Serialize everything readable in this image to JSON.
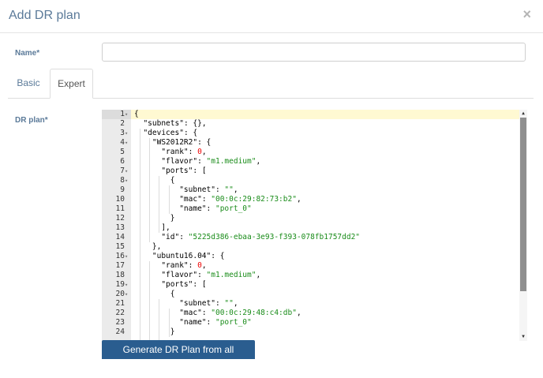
{
  "dialog": {
    "title": "Add DR plan",
    "close_icon": "×"
  },
  "form": {
    "name_label": "Name*",
    "name_value": "",
    "plan_label": "DR plan*"
  },
  "tabs": [
    {
      "label": "Basic",
      "active": false
    },
    {
      "label": "Expert",
      "active": true
    }
  ],
  "editor": {
    "lines": [
      {
        "n": "1",
        "fold": true,
        "active": true,
        "tokens": [
          [
            "pun",
            "{"
          ]
        ]
      },
      {
        "n": "2",
        "fold": false,
        "tokens": [
          [
            "pun",
            "  "
          ],
          [
            "key",
            "\"subnets\""
          ],
          [
            "pun",
            ": {},"
          ]
        ]
      },
      {
        "n": "3",
        "fold": true,
        "tokens": [
          [
            "pun",
            "  "
          ],
          [
            "key",
            "\"devices\""
          ],
          [
            "pun",
            ": {"
          ]
        ]
      },
      {
        "n": "4",
        "fold": true,
        "tokens": [
          [
            "pun",
            "    "
          ],
          [
            "key",
            "\"WS2012R2\""
          ],
          [
            "pun",
            ": {"
          ]
        ]
      },
      {
        "n": "5",
        "fold": false,
        "tokens": [
          [
            "pun",
            "      "
          ],
          [
            "key",
            "\"rank\""
          ],
          [
            "pun",
            ": "
          ],
          [
            "num",
            "0"
          ],
          [
            "pun",
            ","
          ]
        ]
      },
      {
        "n": "6",
        "fold": false,
        "tokens": [
          [
            "pun",
            "      "
          ],
          [
            "key",
            "\"flavor\""
          ],
          [
            "pun",
            ": "
          ],
          [
            "str",
            "\"m1.medium\""
          ],
          [
            "pun",
            ","
          ]
        ]
      },
      {
        "n": "7",
        "fold": true,
        "tokens": [
          [
            "pun",
            "      "
          ],
          [
            "key",
            "\"ports\""
          ],
          [
            "pun",
            ": ["
          ]
        ]
      },
      {
        "n": "8",
        "fold": true,
        "tokens": [
          [
            "pun",
            "        {"
          ]
        ]
      },
      {
        "n": "9",
        "fold": false,
        "tokens": [
          [
            "pun",
            "          "
          ],
          [
            "key",
            "\"subnet\""
          ],
          [
            "pun",
            ": "
          ],
          [
            "str",
            "\"\""
          ],
          [
            "pun",
            ","
          ]
        ]
      },
      {
        "n": "10",
        "fold": false,
        "tokens": [
          [
            "pun",
            "          "
          ],
          [
            "key",
            "\"mac\""
          ],
          [
            "pun",
            ": "
          ],
          [
            "str",
            "\"00:0c:29:82:73:b2\""
          ],
          [
            "pun",
            ","
          ]
        ]
      },
      {
        "n": "11",
        "fold": false,
        "tokens": [
          [
            "pun",
            "          "
          ],
          [
            "key",
            "\"name\""
          ],
          [
            "pun",
            ": "
          ],
          [
            "str",
            "\"port_0\""
          ]
        ]
      },
      {
        "n": "12",
        "fold": false,
        "tokens": [
          [
            "pun",
            "        }"
          ]
        ]
      },
      {
        "n": "13",
        "fold": false,
        "tokens": [
          [
            "pun",
            "      ],"
          ]
        ]
      },
      {
        "n": "14",
        "fold": false,
        "tokens": [
          [
            "pun",
            "      "
          ],
          [
            "key",
            "\"id\""
          ],
          [
            "pun",
            ": "
          ],
          [
            "str",
            "\"5225d386-ebaa-3e93-f393-078fb1757dd2\""
          ]
        ]
      },
      {
        "n": "15",
        "fold": false,
        "tokens": [
          [
            "pun",
            "    },"
          ]
        ]
      },
      {
        "n": "16",
        "fold": true,
        "tokens": [
          [
            "pun",
            "    "
          ],
          [
            "key",
            "\"ubuntu16.04\""
          ],
          [
            "pun",
            ": {"
          ]
        ]
      },
      {
        "n": "17",
        "fold": false,
        "tokens": [
          [
            "pun",
            "      "
          ],
          [
            "key",
            "\"rank\""
          ],
          [
            "pun",
            ": "
          ],
          [
            "num",
            "0"
          ],
          [
            "pun",
            ","
          ]
        ]
      },
      {
        "n": "18",
        "fold": false,
        "tokens": [
          [
            "pun",
            "      "
          ],
          [
            "key",
            "\"flavor\""
          ],
          [
            "pun",
            ": "
          ],
          [
            "str",
            "\"m1.medium\""
          ],
          [
            "pun",
            ","
          ]
        ]
      },
      {
        "n": "19",
        "fold": true,
        "tokens": [
          [
            "pun",
            "      "
          ],
          [
            "key",
            "\"ports\""
          ],
          [
            "pun",
            ": ["
          ]
        ]
      },
      {
        "n": "20",
        "fold": true,
        "tokens": [
          [
            "pun",
            "        {"
          ]
        ]
      },
      {
        "n": "21",
        "fold": false,
        "tokens": [
          [
            "pun",
            "          "
          ],
          [
            "key",
            "\"subnet\""
          ],
          [
            "pun",
            ": "
          ],
          [
            "str",
            "\"\""
          ],
          [
            "pun",
            ","
          ]
        ]
      },
      {
        "n": "22",
        "fold": false,
        "tokens": [
          [
            "pun",
            "          "
          ],
          [
            "key",
            "\"mac\""
          ],
          [
            "pun",
            ": "
          ],
          [
            "str",
            "\"00:0c:29:48:c4:db\""
          ],
          [
            "pun",
            ","
          ]
        ]
      },
      {
        "n": "23",
        "fold": false,
        "tokens": [
          [
            "pun",
            "          "
          ],
          [
            "key",
            "\"name\""
          ],
          [
            "pun",
            ": "
          ],
          [
            "str",
            "\"port_0\""
          ]
        ]
      },
      {
        "n": "24",
        "fold": false,
        "tokens": [
          [
            "pun",
            "        }"
          ]
        ]
      }
    ],
    "fold_icon": "▾",
    "scroll_up_icon": "▲",
    "scroll_down_icon": "▼"
  },
  "actions": {
    "generate_label": "Generate DR Plan from all machines"
  }
}
